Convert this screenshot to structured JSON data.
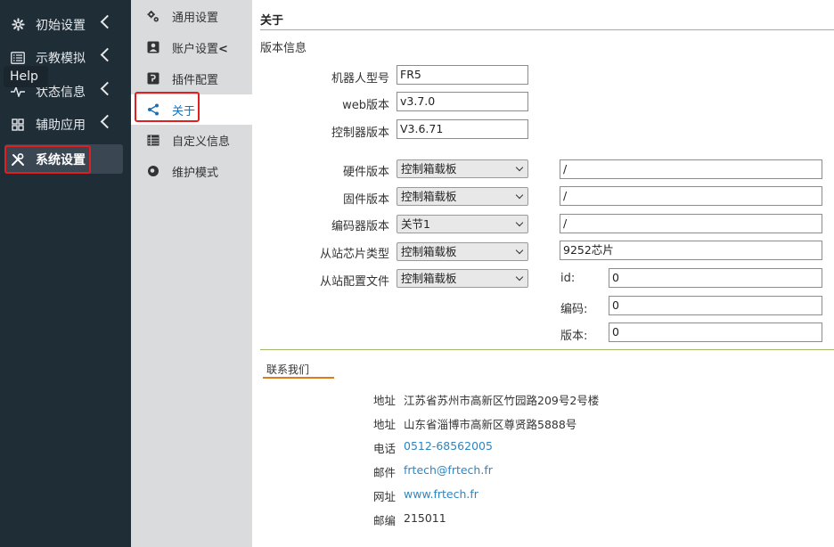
{
  "sidebar": {
    "items": [
      {
        "label": "初始设置",
        "icon": "gear-icon"
      },
      {
        "label": "示教模拟",
        "icon": "list-icon"
      },
      {
        "label": "状态信息",
        "icon": "pulse-icon"
      },
      {
        "label": "辅助应用",
        "icon": "grid-icon"
      },
      {
        "label": "系统设置",
        "icon": "tools-icon"
      }
    ],
    "help_tooltip": "Help"
  },
  "submenu": {
    "items": [
      {
        "label": "通用设置",
        "icon": "gears-icon"
      },
      {
        "label": "账户设置",
        "icon": "account-icon"
      },
      {
        "label": "插件配置",
        "icon": "plugin-icon"
      },
      {
        "label": "关于",
        "icon": "share-icon"
      },
      {
        "label": "自定义信息",
        "icon": "table-icon"
      },
      {
        "label": "维护模式",
        "icon": "maintenance-icon"
      }
    ],
    "account_suffix": "<"
  },
  "main": {
    "title": "关于",
    "section": "版本信息",
    "fields": {
      "robot_model": {
        "label": "机器人型号",
        "value": "FR5"
      },
      "web_version": {
        "label": "web版本",
        "value": "v3.7.0"
      },
      "controller_version": {
        "label": "控制器版本",
        "value": "V3.6.71"
      }
    },
    "hw": {
      "hardware": {
        "label": "硬件版本",
        "select": "控制箱载板",
        "value": "/"
      },
      "firmware": {
        "label": "固件版本",
        "select": "控制箱载板",
        "value": "/"
      },
      "encoder": {
        "label": "编码器版本",
        "select": "关节1",
        "value": "/"
      },
      "slave_chip": {
        "label": "从站芯片类型",
        "select": "控制箱载板",
        "value": "9252芯片"
      },
      "slave_config": {
        "label": "从站配置文件",
        "select": "控制箱载板"
      }
    },
    "slave_detail": {
      "id": {
        "label": "id:",
        "value": "0"
      },
      "code": {
        "label": "编码:",
        "value": "0"
      },
      "version": {
        "label": "版本:",
        "value": "0"
      }
    },
    "contact": {
      "tab": "联系我们",
      "rows": [
        {
          "label": "地址",
          "value": "江苏省苏州市高新区竹园路209号2号楼"
        },
        {
          "label": "地址",
          "value": "山东省淄博市高新区尊贤路5888号"
        },
        {
          "label": "电话",
          "value": "0512-68562005"
        },
        {
          "label": "邮件",
          "value": "frtech@frtech.fr"
        },
        {
          "label": "网址",
          "value": "www.frtech.fr"
        },
        {
          "label": "邮编",
          "value": "215011"
        }
      ]
    }
  },
  "colors": {
    "sidebar_bg": "#1f2d37",
    "submenu_bg": "#d9dbdc",
    "accent_green": "#9fb86a",
    "accent_orange": "#e07b1a",
    "link_blue": "#2e86c1",
    "highlight_red": "#e02020"
  }
}
